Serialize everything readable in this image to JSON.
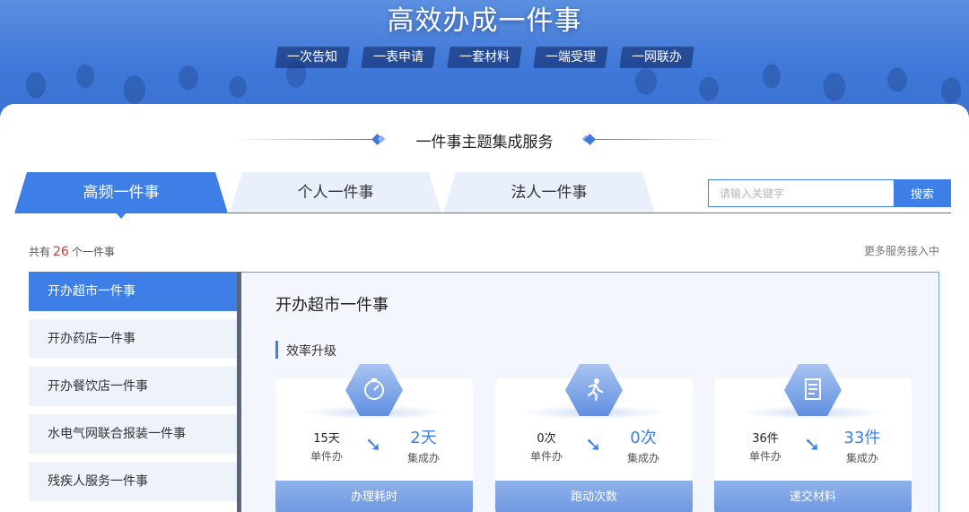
{
  "hero": {
    "title": "高效办成一件事",
    "pills": [
      "一次告知",
      "一表申请",
      "一套材料",
      "一端受理",
      "一网联办"
    ]
  },
  "section": {
    "title": "一件事主题集成服务"
  },
  "tabs": [
    {
      "label": "高频一件事",
      "active": true
    },
    {
      "label": "个人一件事",
      "active": false
    },
    {
      "label": "法人一件事",
      "active": false
    }
  ],
  "search": {
    "placeholder": "请输入关键字",
    "button": "搜索"
  },
  "summary": {
    "prefix": "共有",
    "count": "26",
    "suffix": "个一件事",
    "more": "更多服务接入中"
  },
  "sidebar": {
    "items": [
      {
        "label": "开办超市一件事",
        "active": true
      },
      {
        "label": "开办药店一件事",
        "active": false
      },
      {
        "label": "开办餐饮店一件事",
        "active": false
      },
      {
        "label": "水电气网联合报装一件事",
        "active": false
      },
      {
        "label": "残疾人服务一件事",
        "active": false
      }
    ]
  },
  "detail": {
    "title": "开办超市一件事",
    "subtitle": "效率升级",
    "stats": [
      {
        "icon": "stopwatch-icon",
        "old_value": "15天",
        "old_label": "单件办",
        "new_value": "2天",
        "new_label": "集成办",
        "footer": "办理耗时"
      },
      {
        "icon": "running-person-icon",
        "old_value": "0次",
        "old_label": "单件办",
        "new_value": "0次",
        "new_label": "集成办",
        "footer": "跑动次数"
      },
      {
        "icon": "document-icon",
        "old_value": "36件",
        "old_label": "单件办",
        "new_value": "33件",
        "new_label": "集成办",
        "footer": "递交材料"
      }
    ]
  },
  "colors": {
    "accent": "#3d7fe6",
    "count_highlight": "#d23b3b",
    "hero": "#3f78d8"
  }
}
